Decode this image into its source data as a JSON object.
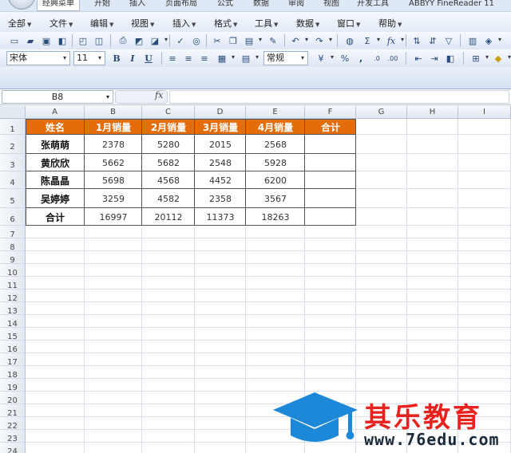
{
  "ribbon_tabs": [
    "经典菜单",
    "开始",
    "插入",
    "页面布局",
    "公式",
    "数据",
    "审阅",
    "视图",
    "开发工具",
    "ABBYY FineReader 11"
  ],
  "menu": [
    "全部",
    "文件",
    "编辑",
    "视图",
    "插入",
    "格式",
    "工具",
    "数据",
    "窗口",
    "帮助"
  ],
  "toolbar": {
    "font_name": "宋体",
    "font_size": "11",
    "bold": "B",
    "italic": "I",
    "underline": "U",
    "number_format": "常规",
    "percent": "%",
    "comma": ",",
    "sum": "Σ",
    "fx": "fx"
  },
  "formula_bar": {
    "name_box": "B8",
    "fx_label": "fx",
    "formula": ""
  },
  "columns": [
    "A",
    "B",
    "C",
    "D",
    "E",
    "F",
    "G",
    "H",
    "I"
  ],
  "rows": [
    "1",
    "2",
    "3",
    "4",
    "5",
    "6",
    "7",
    "8",
    "9",
    "10",
    "11",
    "12",
    "13",
    "14",
    "15",
    "16",
    "17",
    "18",
    "19",
    "20",
    "21",
    "22",
    "23",
    "24"
  ],
  "table": {
    "headers": [
      "姓名",
      "1月销量",
      "2月销量",
      "3月销量",
      "4月销量",
      "合计"
    ],
    "rows": [
      [
        "张萌萌",
        "2378",
        "5280",
        "2015",
        "2568",
        ""
      ],
      [
        "黄欣欣",
        "5662",
        "5682",
        "2548",
        "5928",
        ""
      ],
      [
        "陈晶晶",
        "5698",
        "4568",
        "4452",
        "6200",
        ""
      ],
      [
        "吴婷婷",
        "3259",
        "4582",
        "2358",
        "3567",
        ""
      ],
      [
        "合计",
        "16997",
        "20112",
        "11373",
        "18263",
        ""
      ]
    ]
  },
  "colors": {
    "header_fill": "#e46c0a",
    "header_text": "#ffffff",
    "watermark_red": "#e8231f",
    "watermark_blue": "#1e88d8"
  },
  "watermark": {
    "title": "其乐教育",
    "url": "www.76edu.com"
  }
}
